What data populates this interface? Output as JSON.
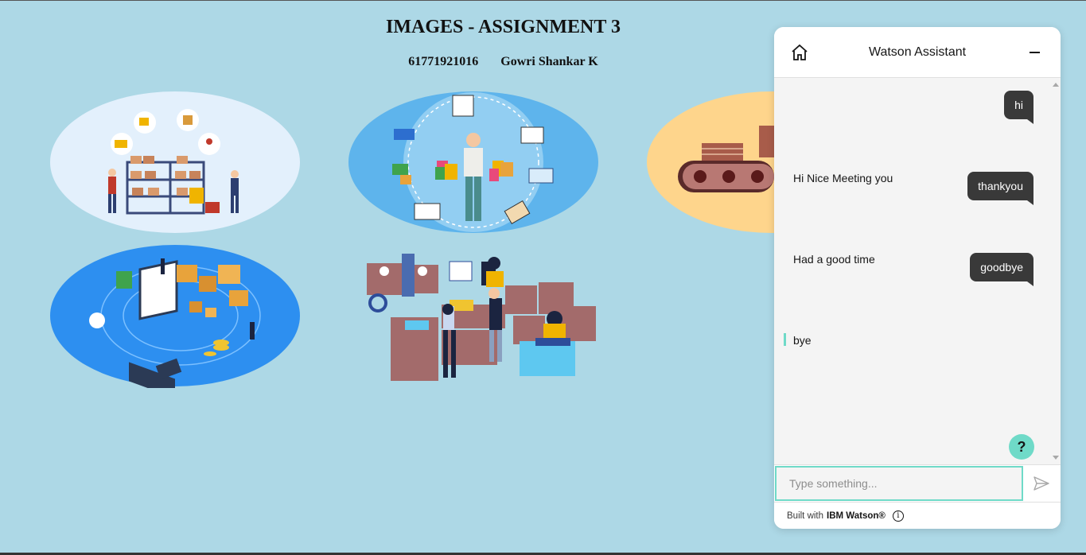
{
  "page": {
    "title": "IMAGES - ASSIGNMENT 3",
    "roll_number": "61771921016",
    "student_name": "Gowri Shankar K"
  },
  "illustrations": [
    {
      "name": "warehouse-shelves-illustration",
      "bg": "#e3f0fc"
    },
    {
      "name": "shopping-customer-illustration",
      "bg": "#5eb4ec"
    },
    {
      "name": "conveyor-belt-illustration",
      "bg": "#fed58c"
    },
    {
      "name": "logistics-laptop-illustration",
      "bg": "#2d8ff0"
    },
    {
      "name": "warehouse-team-illustration",
      "bg": "none"
    }
  ],
  "assistant": {
    "title": "Watson Assistant",
    "messages": [
      {
        "from": "user",
        "text": "hi"
      },
      {
        "from": "bot",
        "text": "Hi Nice Meeting you"
      },
      {
        "from": "user",
        "text": "thankyou"
      },
      {
        "from": "bot",
        "text": "Had a good time"
      },
      {
        "from": "user",
        "text": "goodbye"
      },
      {
        "from": "bot",
        "text": "bye"
      }
    ],
    "help_label": "?",
    "input_placeholder": "Type something...",
    "footer_prefix": "Built with",
    "footer_brand": "IBM Watson®",
    "info_label": "i"
  },
  "colors": {
    "page_bg": "#add8e6",
    "accent": "#6fdac8",
    "user_bubble": "#393939"
  }
}
